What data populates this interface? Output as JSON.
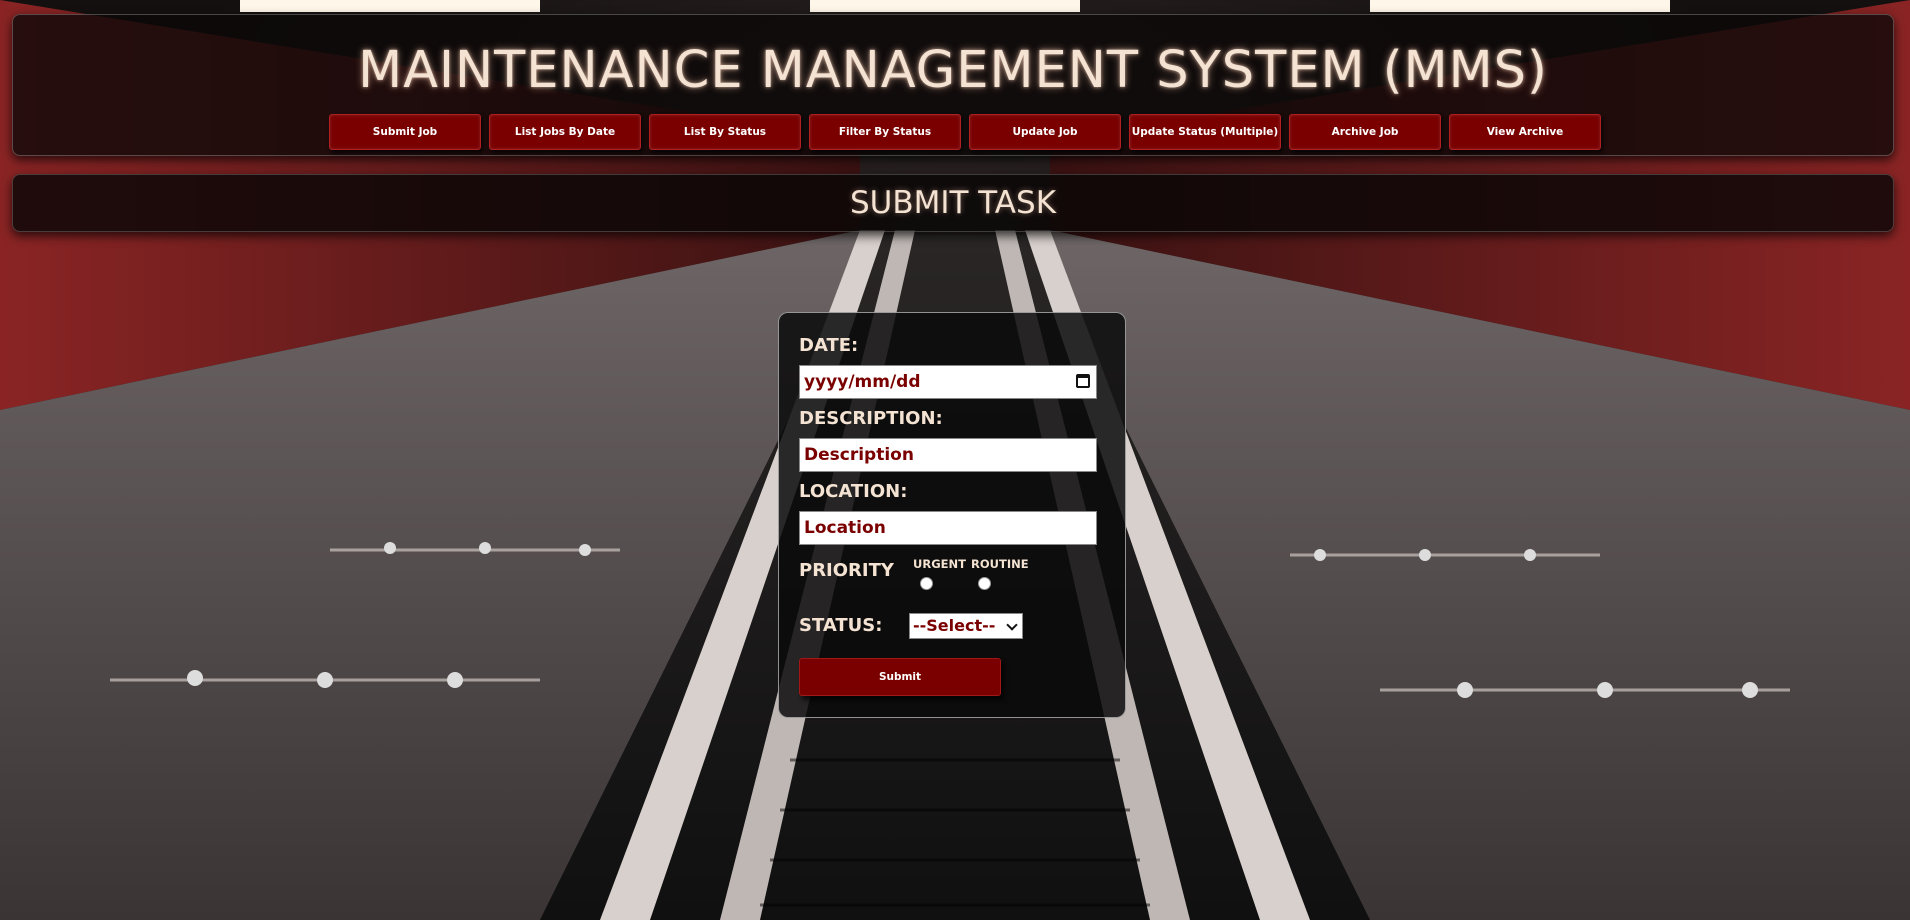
{
  "header": {
    "title": "MAINTENANCE MANAGEMENT SYSTEM (MMS)",
    "nav": [
      {
        "label": "Submit Job"
      },
      {
        "label": "List Jobs By Date"
      },
      {
        "label": "List By Status"
      },
      {
        "label": "Filter By Status"
      },
      {
        "label": "Update Job"
      },
      {
        "label": "Update Status (Multiple)"
      },
      {
        "label": "Archive Job"
      },
      {
        "label": "View Archive"
      }
    ]
  },
  "subheader": {
    "title": "SUBMIT TASK"
  },
  "form": {
    "date_label": "DATE:",
    "date_placeholder": "yyyy/mm/dd",
    "description_label": "DESCRIPTION:",
    "description_placeholder": "Description",
    "location_label": "LOCATION:",
    "location_placeholder": "Location",
    "priority_label": "PRIORITY",
    "priority_options": [
      {
        "label": "URGENT",
        "selected": false
      },
      {
        "label": "ROUTINE",
        "selected": false
      }
    ],
    "status_label": "STATUS:",
    "status_selected": "--Select--",
    "submit_label": "Submit"
  },
  "colors": {
    "accent": "#7a0000",
    "title_text": "#f4e3d2",
    "panel_bg": "#0c0808"
  }
}
